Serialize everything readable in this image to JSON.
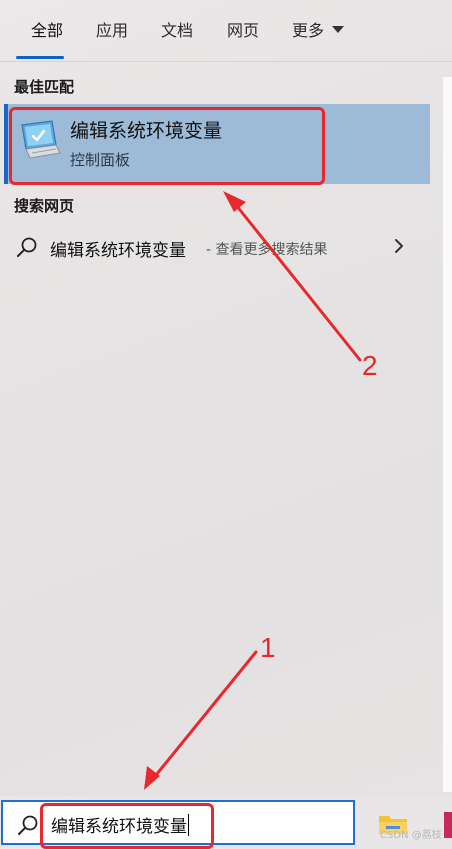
{
  "tabs": [
    {
      "label": "全部",
      "active": true
    },
    {
      "label": "应用",
      "active": false
    },
    {
      "label": "文档",
      "active": false
    },
    {
      "label": "网页",
      "active": false
    },
    {
      "label": "更多",
      "active": false
    }
  ],
  "best_match": {
    "section_title": "最佳匹配",
    "title": "编辑系统环境变量",
    "subtitle": "控制面板",
    "icon": "monitor-icon"
  },
  "web_search": {
    "section_title": "搜索网页",
    "query": "编辑系统环境变量",
    "hint": "- 查看更多搜索结果",
    "icon": "search-icon"
  },
  "annotations": {
    "step1": "1",
    "step2": "2",
    "color": "#e8282d"
  },
  "search_box": {
    "value": "编辑系统环境变量",
    "icon": "search-icon"
  },
  "watermark": "CSDN @荔枝",
  "colors": {
    "accent": "#1a67c8",
    "selected_bg": "#9dbad6",
    "search_border": "#1f6ed4"
  }
}
